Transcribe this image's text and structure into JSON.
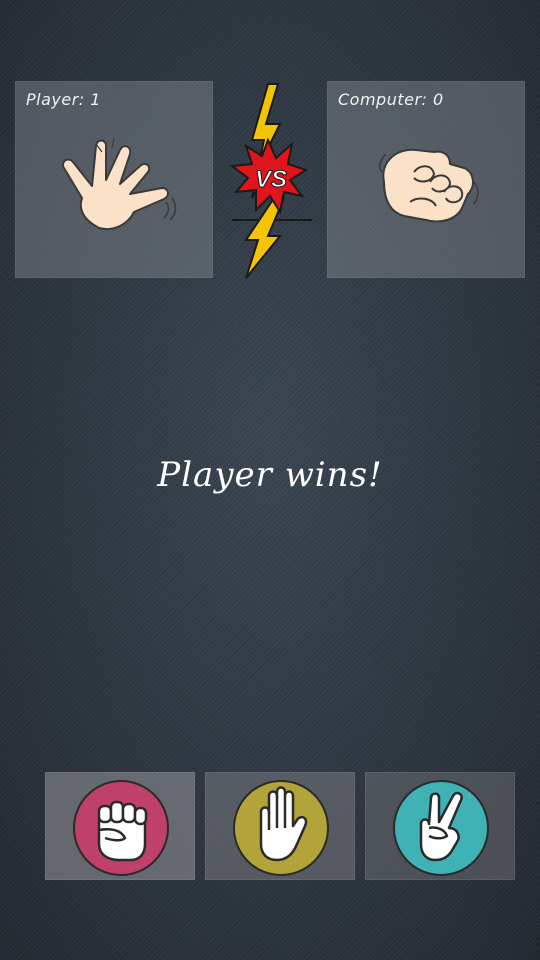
{
  "player_panel": {
    "score_label": "Player: 1",
    "hand": "paper-hand-icon"
  },
  "computer_panel": {
    "score_label": "Computer: 0",
    "hand": "rock-fist-icon"
  },
  "vs_badge": {
    "label": "VS"
  },
  "result": {
    "text": "Player wins!"
  },
  "choices": [
    {
      "name": "rock",
      "icon": "rock-fist-icon",
      "color": "#c0406c"
    },
    {
      "name": "paper",
      "icon": "paper-hand-icon",
      "color": "#b3a43a"
    },
    {
      "name": "scissors",
      "icon": "scissors-hand-icon",
      "color": "#3fb2b5"
    }
  ],
  "colors": {
    "skin": "#fbe1c8",
    "outline": "#3a3a3a",
    "vs_red": "#e0141b",
    "bolt": "#f5c400"
  }
}
